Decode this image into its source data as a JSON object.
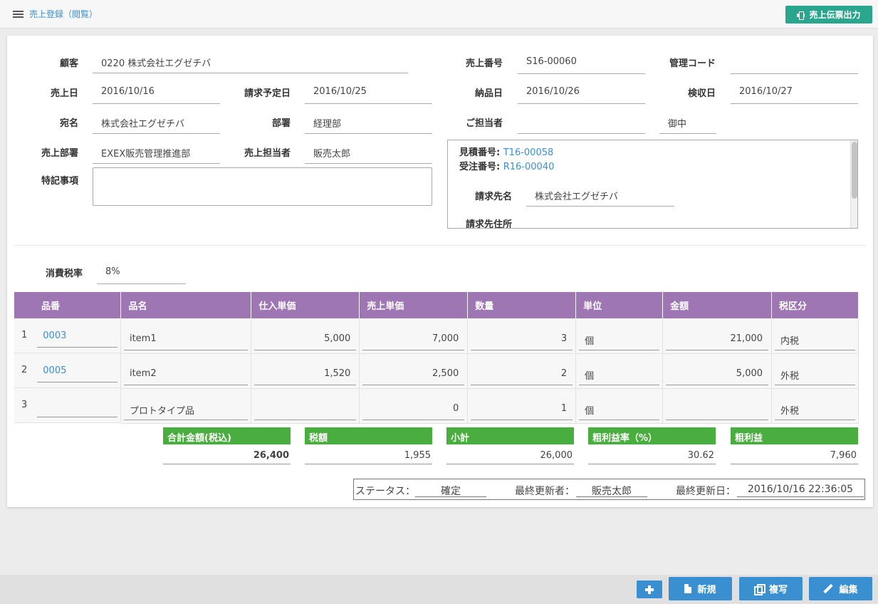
{
  "header": {
    "title": "売上登録（閲覧）",
    "print_label": "売上伝票出力"
  },
  "form": {
    "customer_label": "顧客",
    "customer_value": "0220 株式会社エグゼチバ",
    "sales_no_label": "売上番号",
    "sales_no_value": "S16-00060",
    "mgmt_code_label": "管理コード",
    "mgmt_code_value": "",
    "sales_date_label": "売上日",
    "sales_date_value": "2016/10/16",
    "billing_date_label": "請求予定日",
    "billing_date_value": "2016/10/25",
    "delivery_date_label": "納品日",
    "delivery_date_value": "2016/10/26",
    "acceptance_date_label": "検収日",
    "acceptance_date_value": "2016/10/27",
    "addressee_label": "宛名",
    "addressee_value": "株式会社エグゼチバ",
    "dept_label": "部署",
    "dept_value": "経理部",
    "contact_label": "ご担当者",
    "contact_value": "",
    "honorific_value": "御中",
    "sales_dept_label": "売上部署",
    "sales_dept_value": "EXEX販売管理推進部",
    "sales_rep_label": "売上担当者",
    "sales_rep_value": "販売太郎",
    "notes_label": "特記事項",
    "tax_rate_label": "消費税率",
    "tax_rate_value": "8%"
  },
  "info": {
    "quote_label": "見積番号:",
    "quote_value": "T16-00058",
    "order_label": "受注番号:",
    "order_value": "R16-00040",
    "bill_to_label": "請求先名",
    "bill_to_value": "株式会社エグゼチバ",
    "bill_addr_label": "請求先住所"
  },
  "table": {
    "headers": [
      "品番",
      "品名",
      "仕入単価",
      "売上単価",
      "数量",
      "単位",
      "金額",
      "税区分"
    ],
    "rows": [
      {
        "no": "1",
        "code": "0003",
        "name": "item1",
        "cost": "5,000",
        "price": "7,000",
        "qty": "3",
        "unit": "個",
        "amount": "21,000",
        "tax": "内税"
      },
      {
        "no": "2",
        "code": "0005",
        "name": "item2",
        "cost": "1,520",
        "price": "2,500",
        "qty": "2",
        "unit": "個",
        "amount": "5,000",
        "tax": "外税"
      },
      {
        "no": "3",
        "code": "",
        "name": "プロトタイプ品",
        "cost": "",
        "price": "0",
        "qty": "1",
        "unit": "個",
        "amount": "",
        "tax": "外税"
      }
    ]
  },
  "totals": [
    {
      "label": "合計金額(税込)",
      "value": "26,400"
    },
    {
      "label": "税額",
      "value": "1,955"
    },
    {
      "label": "小計",
      "value": "26,000"
    },
    {
      "label": "粗利益率（%）",
      "value": "30.62"
    },
    {
      "label": "粗利益",
      "value": "7,960"
    }
  ],
  "status": {
    "status_label": "ステータス：",
    "status_value": "確定",
    "updater_label": "最終更新者：",
    "updater_value": "販売太郎",
    "updated_label": "最終更新日：",
    "updated_value": "2016/10/16 22:36:05"
  },
  "footer": {
    "new_label": "新規",
    "copy_label": "複写",
    "edit_label": "編集"
  },
  "colors": {
    "accent": "#3a8fd0",
    "table_header": "#9f76b4",
    "totals_header": "#4aad3f",
    "print_button": "#2aa58e"
  }
}
